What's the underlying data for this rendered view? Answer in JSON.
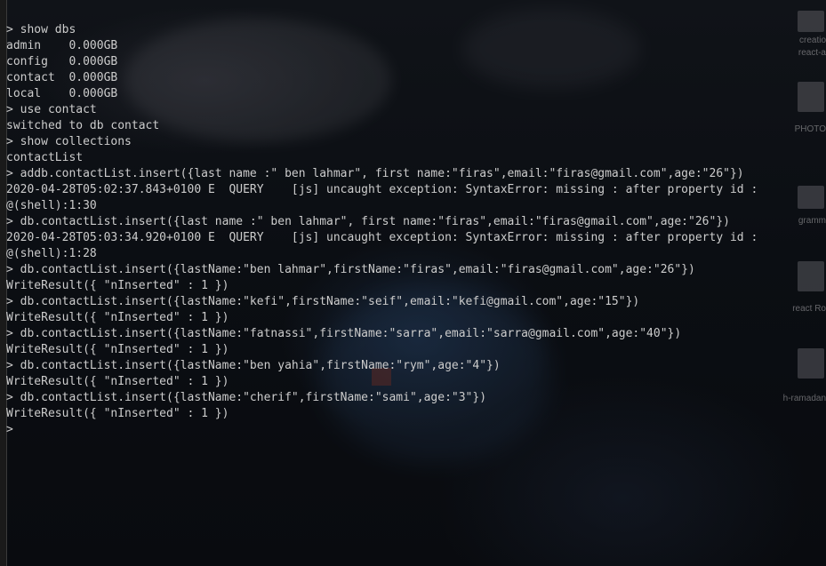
{
  "terminal": {
    "lines": [
      "> show dbs",
      "admin    0.000GB",
      "config   0.000GB",
      "contact  0.000GB",
      "local    0.000GB",
      "> use contact",
      "switched to db contact",
      "> show collections",
      "contactList",
      "> addb.contactList.insert({last name :\" ben lahmar\", first name:\"firas\",email:\"firas@gmail.com\",age:\"26\"})",
      "2020-04-28T05:02:37.843+0100 E  QUERY    [js] uncaught exception: SyntaxError: missing : after property id :",
      "@(shell):1:30",
      "> db.contactList.insert({last name :\" ben lahmar\", first name:\"firas\",email:\"firas@gmail.com\",age:\"26\"})",
      "2020-04-28T05:03:34.920+0100 E  QUERY    [js] uncaught exception: SyntaxError: missing : after property id :",
      "@(shell):1:28",
      "> db.contactList.insert({lastName:\"ben lahmar\",firstName:\"firas\",email:\"firas@gmail.com\",age:\"26\"})",
      "WriteResult({ \"nInserted\" : 1 })",
      "> db.contactList.insert({lastName:\"kefi\",firstName:\"seif\",email:\"kefi@gmail.com\",age:\"15\"})",
      "WriteResult({ \"nInserted\" : 1 })",
      "> db.contactList.insert({lastName:\"fatnassi\",firstName:\"sarra\",email:\"sarra@gmail.com\",age:\"40\"})",
      "WriteResult({ \"nInserted\" : 1 })",
      "> db.contactList.insert({lastName:\"ben yahia\",firstName:\"rym\",age:\"4\"})",
      "WriteResult({ \"nInserted\" : 1 })",
      "> db.contactList.insert({lastName:\"cherif\",firstName:\"sami\",age:\"3\"})",
      "WriteResult({ \"nInserted\" : 1 })",
      ">"
    ],
    "text_color": "#cccccc"
  },
  "desktop_icons": [
    {
      "icon": "app-icon",
      "label_1": "creatio",
      "label_2": "react-a"
    },
    {
      "icon": "folder-icon",
      "label_1": "PHOTO",
      "label_2": ""
    },
    {
      "icon": "app-icon",
      "label_1": "gramm",
      "label_2": ""
    },
    {
      "icon": "folder-icon",
      "label_1": "react Ro",
      "label_2": ""
    },
    {
      "icon": "folder-icon",
      "label_1": "h-ramadan",
      "label_2": ""
    }
  ]
}
